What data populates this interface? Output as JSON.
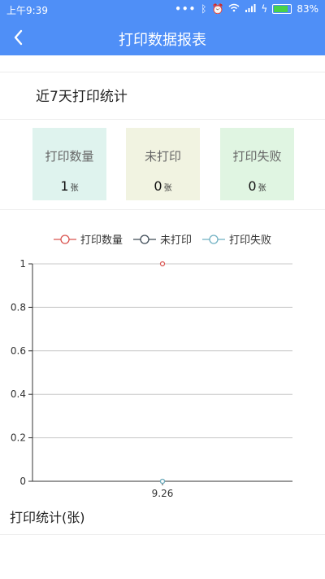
{
  "status": {
    "time": "上午9:39",
    "icons": [
      "more-dots-icon",
      "bluetooth-icon",
      "alarm-icon",
      "wifi-icon",
      "signal-icon",
      "charging-icon",
      "battery-icon"
    ],
    "battery": "83%",
    "battery_level": 0.83
  },
  "header": {
    "title": "打印数据报表"
  },
  "section": {
    "title": "近7天打印统计"
  },
  "cards": [
    {
      "label": "打印数量",
      "value": "1",
      "unit": "张",
      "color": "#dff3ee"
    },
    {
      "label": "未打印",
      "value": "0",
      "unit": "张",
      "color": "#f1f3e1"
    },
    {
      "label": "打印失败",
      "value": "0",
      "unit": "张",
      "color": "#e0f5e2"
    }
  ],
  "legend": [
    {
      "label": "打印数量",
      "color": "#d9534f"
    },
    {
      "label": "未打印",
      "color": "#3d4a55"
    },
    {
      "label": "打印失败",
      "color": "#6fb0c2"
    }
  ],
  "chart_data": {
    "type": "line",
    "categories": [
      "9.26"
    ],
    "series": [
      {
        "name": "打印数量",
        "values": [
          1
        ],
        "color": "#d9534f"
      },
      {
        "name": "未打印",
        "values": [
          0
        ],
        "color": "#3d4a55"
      },
      {
        "name": "打印失败",
        "values": [
          0
        ],
        "color": "#6fb0c2"
      }
    ],
    "ylim": [
      0,
      1
    ],
    "yticks": [
      "0",
      "0.2",
      "0.4",
      "0.6",
      "0.8",
      "1"
    ],
    "grid": true,
    "legend_position": "top"
  },
  "footer": {
    "title": "打印统计(张)"
  }
}
